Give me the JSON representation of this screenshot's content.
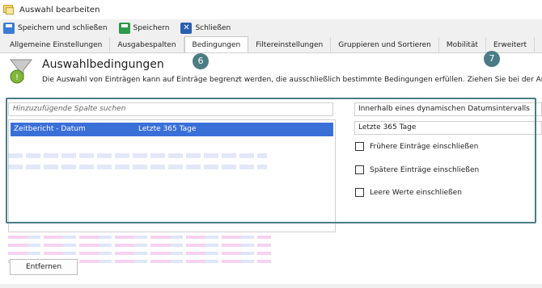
{
  "window": {
    "title": "Auswahl bearbeiten"
  },
  "toolbar": {
    "save_close_label": "Speichern und schließen",
    "save_label": "Speichern",
    "close_label": "Schließen"
  },
  "tabs": [
    {
      "label": "Allgemeine Einstellungen"
    },
    {
      "label": "Ausgabespalten"
    },
    {
      "label": "Bedingungen"
    },
    {
      "label": "Filtereinstellungen"
    },
    {
      "label": "Gruppieren und Sortieren"
    },
    {
      "label": "Mobilität"
    },
    {
      "label": "Erweitert"
    }
  ],
  "active_tab": "Bedingungen",
  "section": {
    "title": "Auswahlbedingungen",
    "description": "Die Auswahl von Einträgen kann auf Einträge begrenzt werden, die ausschließlich bestimmte Bedingungen erfüllen. Ziehen Sie bei der Auswahl"
  },
  "badges": {
    "tab": "6",
    "extended": "7"
  },
  "search": {
    "placeholder": "Hinzuzufügende Spalte suchen"
  },
  "conditions": [
    {
      "column": "Zeitbericht - Datum",
      "value": "Letzte 365 Tage",
      "selected": true
    }
  ],
  "detail": {
    "interval_type": "Innerhalb eines dynamischen Datumsintervalls",
    "interval_value": "Letzte 365 Tage",
    "checkboxes": [
      {
        "label": "Frühere Einträge einschließen",
        "checked": false
      },
      {
        "label": "Spätere Einträge einschließen",
        "checked": false
      },
      {
        "label": "Leere Werte einschließen",
        "checked": false
      }
    ]
  },
  "remove_button": {
    "label": "Entfernen"
  },
  "colors": {
    "accent": "#4b7c84",
    "selection": "#3a6fd8"
  }
}
